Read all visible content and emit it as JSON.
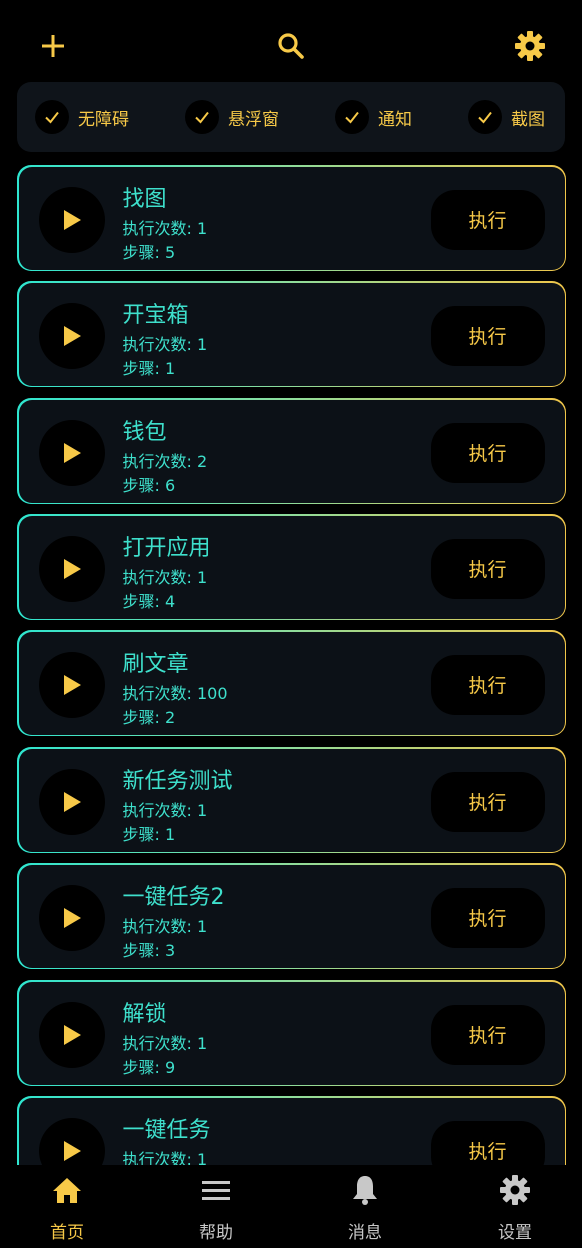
{
  "header": {
    "add_icon": "plus-icon",
    "search_icon": "search-icon",
    "settings_icon": "gear-icon",
    "accent_color": "#f7c948"
  },
  "permissions": [
    {
      "label": "无障碍",
      "checked": true
    },
    {
      "label": "悬浮窗",
      "checked": true
    },
    {
      "label": "通知",
      "checked": true
    },
    {
      "label": "截图",
      "checked": true
    }
  ],
  "tasks": [
    {
      "name": "找图",
      "runs": "执行次数: 1",
      "steps": "步骤: 5",
      "action": "执行"
    },
    {
      "name": "开宝箱",
      "runs": "执行次数: 1",
      "steps": "步骤: 1",
      "action": "执行"
    },
    {
      "name": "钱包",
      "runs": "执行次数: 2",
      "steps": "步骤: 6",
      "action": "执行"
    },
    {
      "name": "打开应用",
      "runs": "执行次数: 1",
      "steps": "步骤: 4",
      "action": "执行"
    },
    {
      "name": "刷文章",
      "runs": "执行次数: 100",
      "steps": "步骤: 2",
      "action": "执行"
    },
    {
      "name": "新任务测试",
      "runs": "执行次数: 1",
      "steps": "步骤: 1",
      "action": "执行"
    },
    {
      "name": "一键任务2",
      "runs": "执行次数: 1",
      "steps": "步骤: 3",
      "action": "执行"
    },
    {
      "name": "解锁",
      "runs": "执行次数: 1",
      "steps": "步骤: 9",
      "action": "执行"
    },
    {
      "name": "一键任务",
      "runs": "执行次数: 1",
      "steps": "",
      "action": "执行"
    }
  ],
  "nav": [
    {
      "label": "首页",
      "icon": "home-icon",
      "active": true
    },
    {
      "label": "帮助",
      "icon": "menu-icon",
      "active": false
    },
    {
      "label": "消息",
      "icon": "bell-icon",
      "active": false
    },
    {
      "label": "设置",
      "icon": "gear-icon",
      "active": false
    }
  ],
  "colors": {
    "accent": "#f7c948",
    "task_text": "#3ee0cc",
    "card_bg": "#0c1117"
  }
}
